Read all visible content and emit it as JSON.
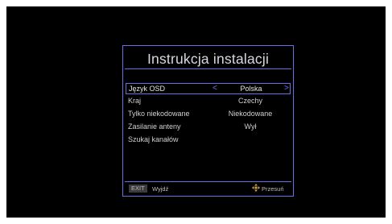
{
  "dialog": {
    "title": "Instrukcja instalacji",
    "rows": [
      {
        "label": "Język OSD",
        "value": "Polska",
        "selected": true,
        "arrow_left": "<",
        "arrow_right": ">"
      },
      {
        "label": "Kraj",
        "value": "Czechy"
      },
      {
        "label": "Tylko niekodowane",
        "value": "Niekodowane"
      },
      {
        "label": "Zasilanie anteny",
        "value": "Wył"
      },
      {
        "label": "Szukaj kanałów",
        "value": ""
      }
    ],
    "footer": {
      "exit_key": "EXIT",
      "exit_label": "Wyjdź",
      "move_label": "Przesuń",
      "move_icon": "four-way-arrow-icon"
    }
  },
  "colors": {
    "accent": "#6a6fe8",
    "background": "#000000",
    "text": "#cfcfcf"
  }
}
